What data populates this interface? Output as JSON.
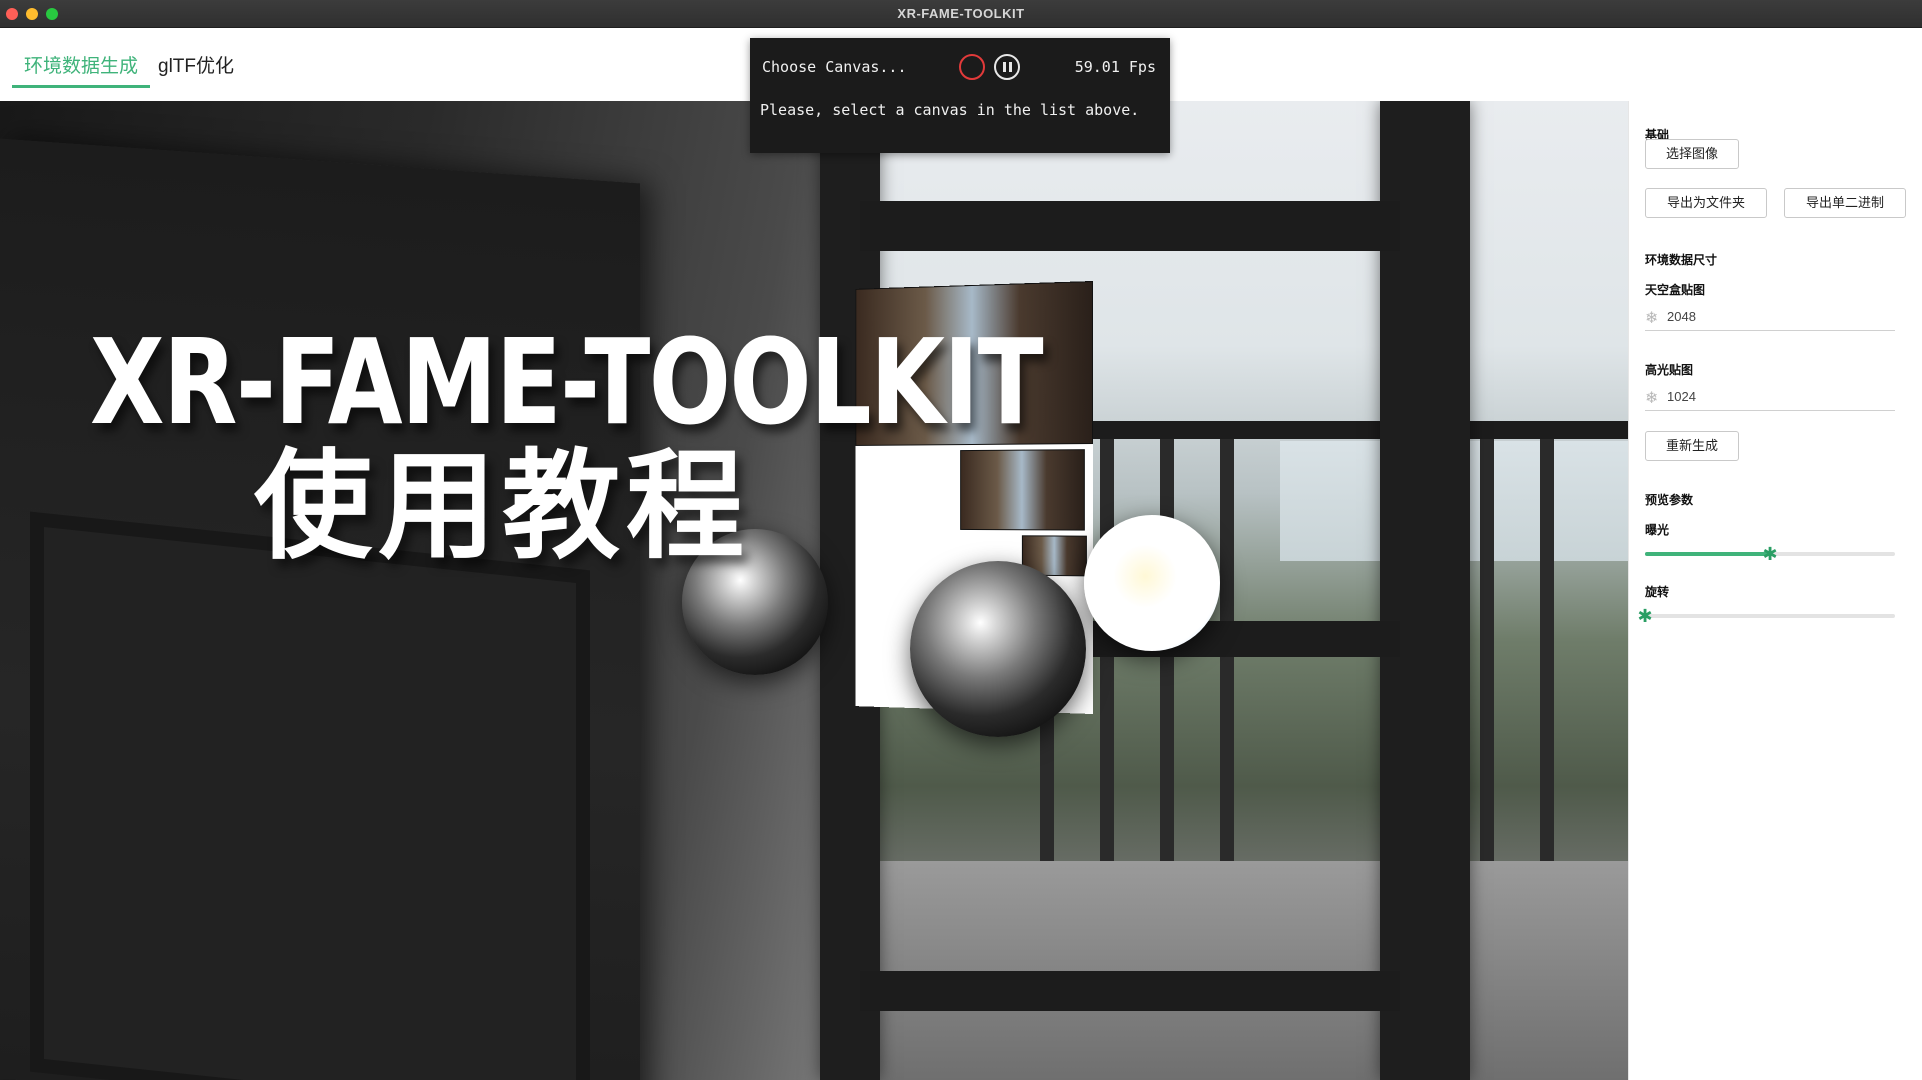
{
  "window": {
    "title": "XR-FAME-TOOLKIT"
  },
  "tabs": [
    {
      "label": "环境数据生成",
      "active": true
    },
    {
      "label": "glTF优化",
      "active": false
    }
  ],
  "overlay": {
    "line1": "XR-FAME-TOOLKIT",
    "line2": "使用教程"
  },
  "canvas_popup": {
    "select_label": "Choose Canvas...",
    "fps": "59.01 Fps",
    "message": "Please, select a canvas in the list above."
  },
  "sidepanel": {
    "basic_label": "基础",
    "choose_image": "选择图像",
    "export_folder": "导出为文件夹",
    "export_binary": "导出单二进制",
    "env_size_label": "环境数据尺寸",
    "skybox_label": "天空盒贴图",
    "skybox_value": "2048",
    "specular_label": "高光贴图",
    "specular_value": "1024",
    "regenerate": "重新生成",
    "preview_label": "预览参数",
    "exposure_label": "曝光",
    "exposure_value": 0.5,
    "rotation_label": "旋转",
    "rotation_value": 0.0
  },
  "colors": {
    "accent": "#3fb37a",
    "record": "#e23a3a",
    "popup_bg": "#1b1b1b"
  },
  "icons": {
    "close": "close-icon",
    "minimize": "minimize-icon",
    "maximize": "maximize-icon",
    "record": "record-icon",
    "pause": "pause-icon",
    "input_prefix": "snowflake-icon",
    "slider_thumb": "slider-thumb-icon"
  }
}
